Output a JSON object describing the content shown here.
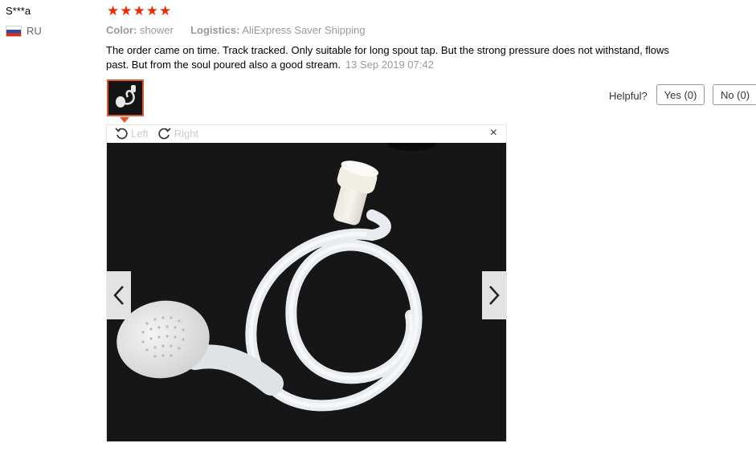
{
  "reviewer": {
    "name": "S***a",
    "country": "RU"
  },
  "rating": {
    "stars": 5,
    "max": 5
  },
  "meta": {
    "color_label": "Color:",
    "color_value": "shower",
    "logistics_label": "Logistics:",
    "logistics_value": "AliExpress Saver Shipping"
  },
  "review": {
    "text": "The order came on time. Track tracked. Only suitable for long spout tap. But the strong pressure does not withstand, flows past. But from the soul poured also a good stream.",
    "date": "13 Sep 2019 07:42"
  },
  "helpful": {
    "label": "Helpful?",
    "yes": "Yes (0)",
    "no": "No (0)"
  },
  "viewer": {
    "rotate_left": "Left",
    "rotate_right": "Right",
    "close": "×"
  },
  "colors": {
    "accent": "#e62e04",
    "thumb_border": "#e0552b"
  }
}
